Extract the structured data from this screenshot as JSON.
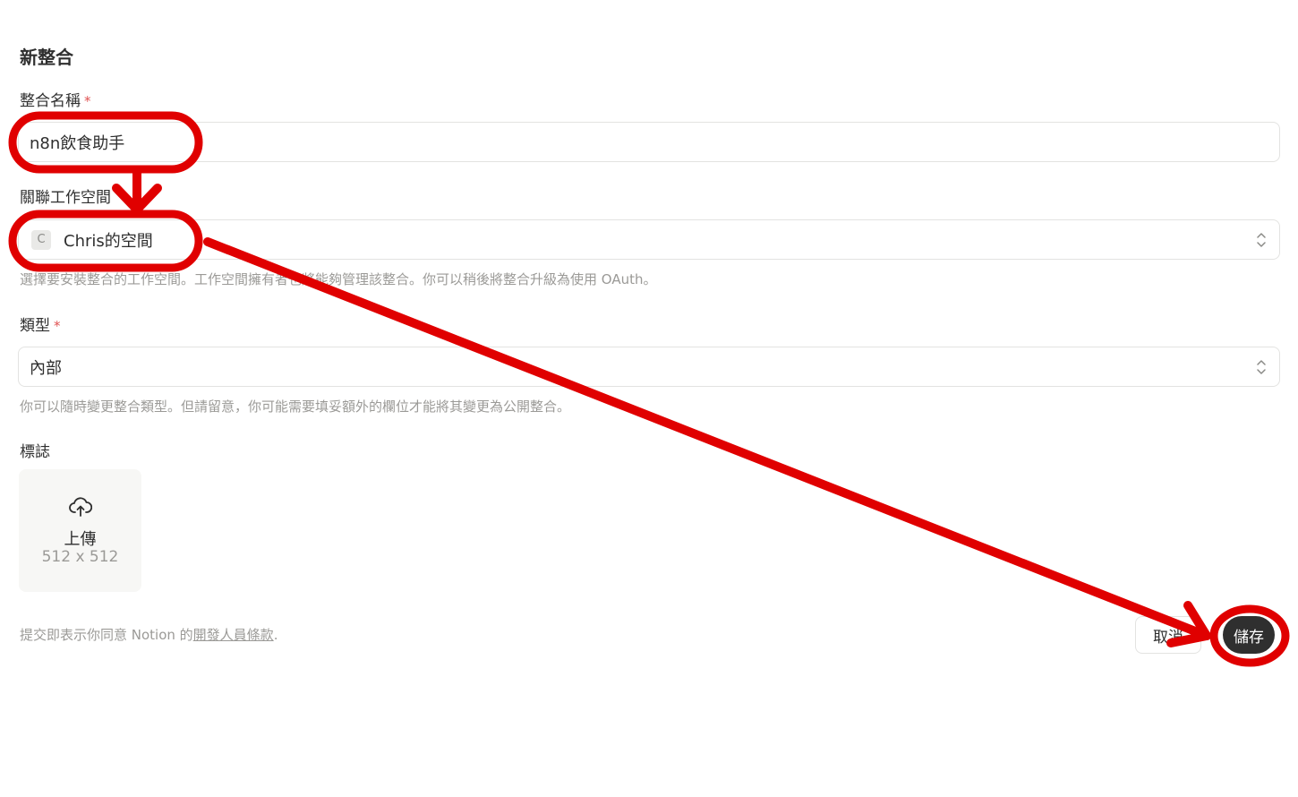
{
  "page": {
    "title": "新整合"
  },
  "form": {
    "name": {
      "label": "整合名稱",
      "required_mark": "*",
      "value": "n8n飲食助手"
    },
    "workspace": {
      "label": "關聯工作空間",
      "badge": "C",
      "value": "Chris的空間",
      "hint": "選擇要安裝整合的工作空間。工作空間擁有者也將能夠管理該整合。你可以稍後將整合升級為使用 OAuth。"
    },
    "type": {
      "label": "類型",
      "required_mark": "*",
      "value": "內部",
      "hint": "你可以隨時變更整合類型。但請留意，你可能需要填妥額外的欄位才能將其變更為公開整合。"
    },
    "logo": {
      "label": "標誌",
      "upload_label": "上傳",
      "upload_size": "512 x 512"
    }
  },
  "footer": {
    "terms_prefix": "提交即表示你同意 Notion 的",
    "terms_link": "開發人員條款",
    "terms_suffix": ".",
    "cancel_label": "取消",
    "save_label": "儲存"
  },
  "annotation": {
    "color": "#e00000"
  },
  "icons": [
    "upload-cloud-icon",
    "chevron-updown-icon"
  ]
}
